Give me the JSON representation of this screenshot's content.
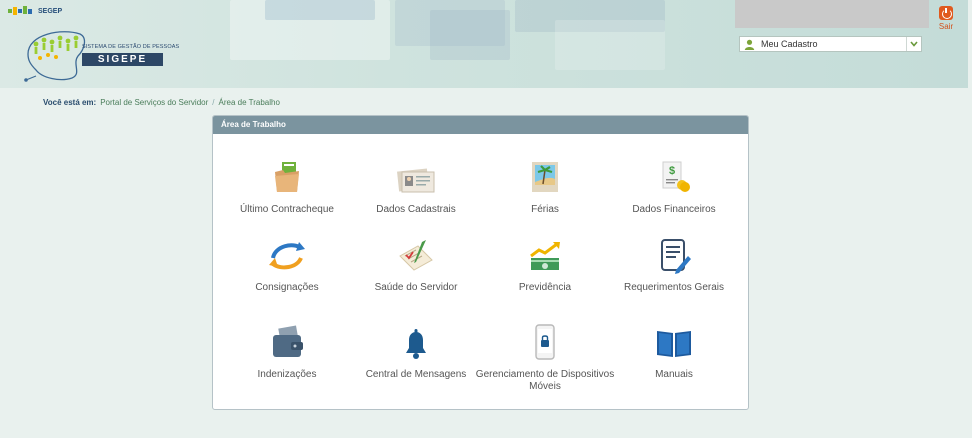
{
  "header": {
    "segep_logo_text": "SEGEP",
    "system_name": "SISTEMA DE GESTÃO DE PESSOAS",
    "system_abbr": "SIGEPE",
    "user_menu": {
      "selected": "Meu Cadastro"
    },
    "logout_label": "Sair"
  },
  "breadcrumb": {
    "lead": "Você está em:",
    "items": [
      "Portal de Serviços do Servidor",
      "Área de Trabalho"
    ],
    "separator": "/"
  },
  "panel": {
    "title": "Área de Trabalho",
    "tiles": [
      {
        "label": "Último Contracheque",
        "icon": "folder-paycheck-icon"
      },
      {
        "label": "Dados Cadastrais",
        "icon": "id-cards-icon"
      },
      {
        "label": "Férias",
        "icon": "vacation-picture-icon"
      },
      {
        "label": "Dados Financeiros",
        "icon": "money-document-icon"
      },
      {
        "label": "Consignações",
        "icon": "refresh-arrows-icon"
      },
      {
        "label": "Saúde do Servidor",
        "icon": "health-checklist-icon"
      },
      {
        "label": "Previdência",
        "icon": "growth-money-icon"
      },
      {
        "label": "Requerimentos Gerais",
        "icon": "document-edit-icon"
      },
      {
        "label": "Indenizações",
        "icon": "wallet-icon"
      },
      {
        "label": "Central de Mensagens",
        "icon": "bell-icon"
      },
      {
        "label": "Gerenciamento de Dispositivos Móveis",
        "icon": "mobile-lock-icon"
      },
      {
        "label": "Manuais",
        "icon": "open-book-icon"
      }
    ]
  },
  "colors": {
    "panel_header": "#7b949f",
    "brand_dark": "#2d4766",
    "accent_orange": "#e05a1e",
    "bell_blue": "#1d5a8e"
  }
}
